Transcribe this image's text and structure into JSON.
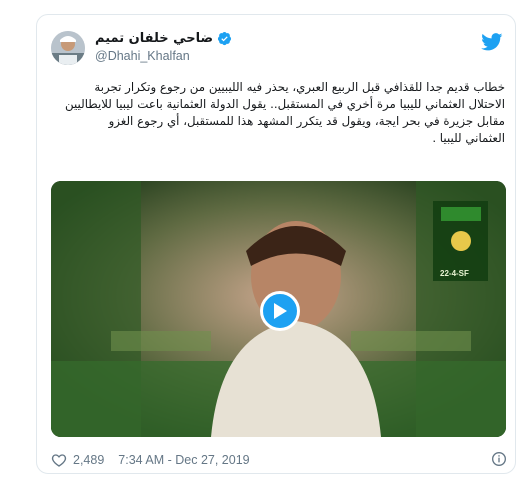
{
  "tweet": {
    "author": {
      "display_name": "ضاحي خلفان تميم",
      "handle": "@Dhahi_Khalfan",
      "verified": true
    },
    "text": "خطاب قديم جدا للقذافي قبل الربيع العبري، يحذر فيه الليبيين من رجوع وتكرار تجربة\nالاحتلال العثماني لليبيا مرة أخري في المستقبل.. يقول الدولة العثمانية باعت ليبيا للايطاليين\nمقابل جزيرة في بحر ايجة، ويقول قد يتكرر المشهد هذا للمستقبل، أي رجوع الغزو\nالعثماني لليبيا .",
    "media": {
      "type": "video",
      "overlay_text": "22-4-SF"
    },
    "likes": "2,489",
    "timestamp": "7:34 AM - Dec 27, 2019"
  },
  "colors": {
    "brand": "#1da1f2",
    "secondary_text": "#657786",
    "border": "#e1e8ed"
  },
  "icons": [
    "twitter-bird-icon",
    "verified-badge-icon",
    "play-icon",
    "heart-icon",
    "info-icon"
  ]
}
